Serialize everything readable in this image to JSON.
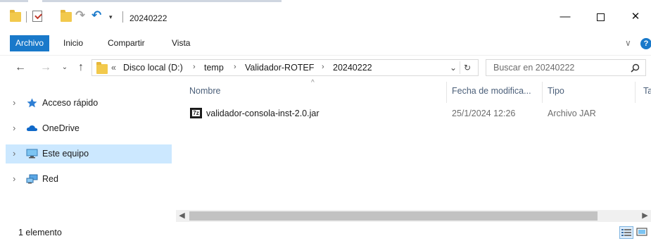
{
  "window": {
    "title": "20240222",
    "minimize_glyph": "—",
    "close_glyph": "✕"
  },
  "ribbon": {
    "tabs": [
      {
        "label": "Archivo",
        "active": true
      },
      {
        "label": "Inicio"
      },
      {
        "label": "Compartir"
      },
      {
        "label": "Vista"
      }
    ],
    "help_glyph": "?",
    "collapse_glyph": "∨"
  },
  "address": {
    "overflow": "«",
    "crumbs": [
      "Disco local (D:)",
      "temp",
      "Validador-ROTEF",
      "20240222"
    ],
    "separator": "›"
  },
  "search": {
    "placeholder": "Buscar en 20240222"
  },
  "nav_pane": {
    "items": [
      {
        "label": "Acceso rápido",
        "icon": "star-pin-icon",
        "selected": false
      },
      {
        "label": "OneDrive",
        "icon": "cloud-icon",
        "selected": false
      },
      {
        "label": "Este equipo",
        "icon": "monitor-icon",
        "selected": true
      },
      {
        "label": "Red",
        "icon": "network-icon",
        "selected": false
      }
    ]
  },
  "file_list": {
    "columns": [
      "Nombre",
      "Fecha de modifica...",
      "Tipo",
      "Ta"
    ],
    "sort_glyph": "^",
    "rows": [
      {
        "name": "validador-consola-inst-2.0.jar",
        "modified": "25/1/2024 12:26",
        "type": "Archivo JAR",
        "icon": "7z-archive-icon",
        "icon_label": "7z"
      }
    ]
  },
  "status": {
    "text": "1 elemento"
  },
  "colors": {
    "accent": "#1979ca",
    "selection": "#cce8ff",
    "folder": "#f2c94c"
  }
}
